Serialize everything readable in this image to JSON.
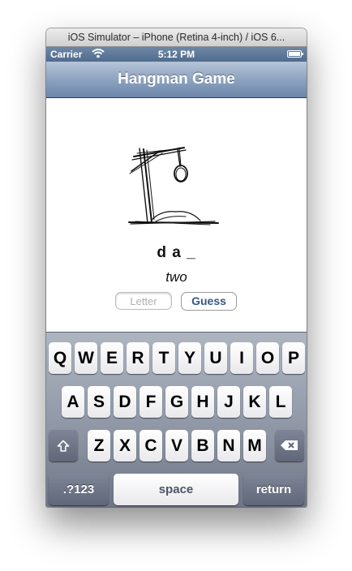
{
  "simulator": {
    "title": "iOS Simulator – iPhone (Retina 4-inch) / iOS 6..."
  },
  "status_bar": {
    "carrier": "Carrier",
    "time": "5:12 PM"
  },
  "nav": {
    "title": "Hangman Game"
  },
  "game": {
    "word": "d a _",
    "hint": "two",
    "letter_placeholder": "Letter",
    "letter_value": "",
    "guess_label": "Guess"
  },
  "keyboard": {
    "row1": [
      "Q",
      "W",
      "E",
      "R",
      "T",
      "Y",
      "U",
      "I",
      "O",
      "P"
    ],
    "row2": [
      "A",
      "S",
      "D",
      "F",
      "G",
      "H",
      "J",
      "K",
      "L"
    ],
    "row3": [
      "Z",
      "X",
      "C",
      "V",
      "B",
      "N",
      "M"
    ],
    "numbers_label": ".?123",
    "space_label": "space",
    "return_label": "return"
  },
  "colors": {
    "nav_bar": "#8da3c0",
    "status_bar": "#5b7699",
    "button_text": "#375785",
    "keyboard": "#8c94a3"
  }
}
